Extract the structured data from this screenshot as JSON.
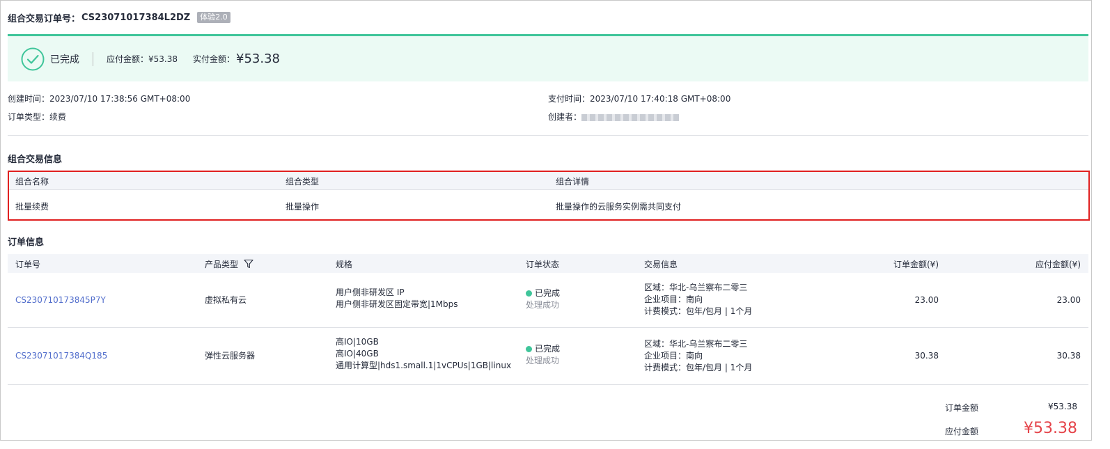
{
  "header": {
    "title_label": "组合交易订单号：",
    "order_id": "CS23071017384L2DZ",
    "badge": "体验2.0"
  },
  "status": {
    "label": "已完成",
    "payable_label": "应付金额：",
    "payable_value": "¥53.38",
    "actual_label": "实付金额：",
    "actual_value": "¥53.38",
    "accent_color": "#3fc59a",
    "icon": "check-circle-icon"
  },
  "meta": {
    "created_label": "创建时间：",
    "created_value": "2023/07/10 17:38:56 GMT+08:00",
    "order_type_label": "订单类型：",
    "order_type_value": "续费",
    "paid_label": "支付时间：",
    "paid_value": "2023/07/10 17:40:18 GMT+08:00",
    "creator_label": "创建者："
  },
  "combo": {
    "section_title": "组合交易信息",
    "columns": [
      "组合名称",
      "组合类型",
      "组合详情"
    ],
    "row": [
      "批量续费",
      "批量操作",
      "批量操作的云服务实例需共同支付"
    ]
  },
  "orders": {
    "section_title": "订单信息",
    "columns": [
      "订单号",
      "产品类型",
      "规格",
      "订单状态",
      "交易信息",
      "订单金额(¥)",
      "应付金额(¥)"
    ],
    "rows": [
      {
        "id": "CS230710173845P7Y",
        "product": "虚拟私有云",
        "spec": [
          "用户侧非研发区 IP",
          "用户侧非研发区固定带宽|1Mbps"
        ],
        "status": "已完成",
        "status_sub": "处理成功",
        "trade": [
          "区域：华北-乌兰察布二零三",
          "企业项目：南向",
          "计费模式：包年/包月 | 1个月"
        ],
        "amount": "23.00",
        "payable": "23.00"
      },
      {
        "id": "CS23071017384Q185",
        "product": "弹性云服务器",
        "spec": [
          "高IO|10GB",
          "高IO|40GB",
          "通用计算型|hds1.small.1|1vCPUs|1GB|linux"
        ],
        "status": "已完成",
        "status_sub": "处理成功",
        "trade": [
          "区域：华北-乌兰察布二零三",
          "企业项目：南向",
          "计费模式：包年/包月 | 1个月"
        ],
        "amount": "30.38",
        "payable": "30.38"
      }
    ]
  },
  "summary": {
    "order_amount_label": "订单金额",
    "order_amount_value": "¥53.38",
    "payable_label": "应付金额",
    "payable_value": "¥53.38",
    "payable_color": "#e5444a"
  }
}
